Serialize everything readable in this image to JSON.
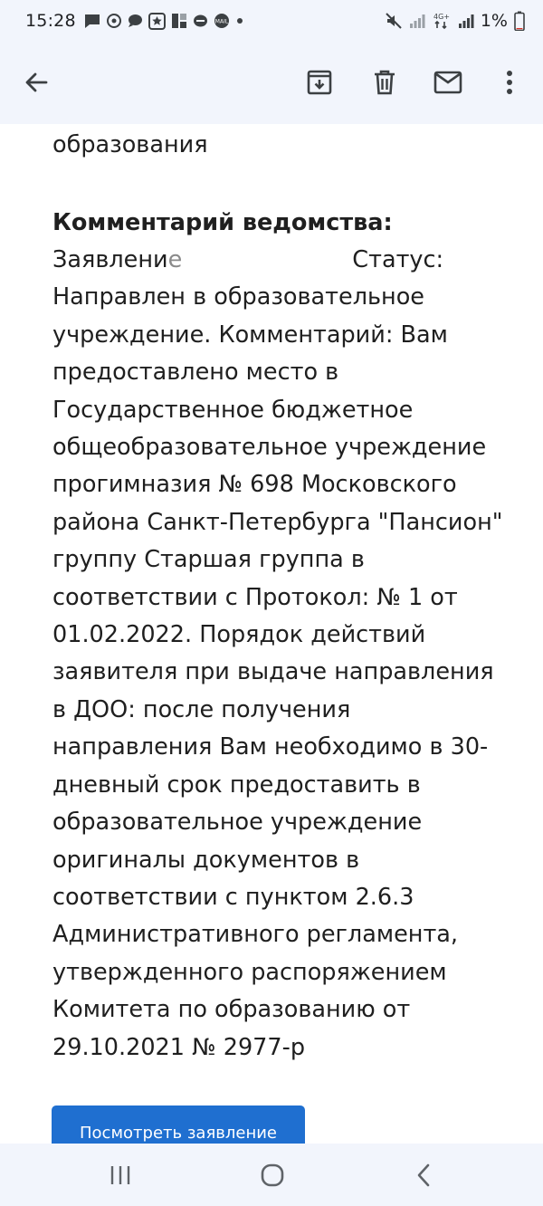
{
  "status_bar": {
    "time": "15:28",
    "battery": "1%",
    "network": "4G+",
    "notification_icons": [
      "message-icon",
      "whatsapp-icon",
      "chat-icon",
      "star-app-icon",
      "app-grid-icon",
      "chat-bubble-icon",
      "mail-ru-icon",
      "dot-icon"
    ],
    "mail_ru_label": "MAIL"
  },
  "toolbar": {
    "actions": [
      "back-arrow-icon",
      "archive-icon",
      "delete-icon",
      "mail-icon",
      "more-vert-icon"
    ]
  },
  "email": {
    "prev_line": "образования",
    "comment_title": "Комментарий ведомства:",
    "body_start": "Заявлени",
    "body_partial": "е",
    "body_after_redact": "Статус: Направлен в образовательное учреждение. Комментарий: Вам предоставлено место в Государственное бюджетное общеобразовательное учреждение прогимназия № 698 Московского района Санкт-Петербурга \"Пансион\" группу Старшая группа в соответствии с Протокол: № 1 от 01.02.2022. Порядок действий заявителя при выдаче направления в ДОО: после получения направления Вам необходимо в 30-дневный срок предоставить в образовательное учреждение оригиналы документов в соответствии с пунктом 2.6.3 Административного регламента, утвержденного распоряжением Комитета по образованию от 29.10.2021 № 2977-р",
    "view_button": "Посмотреть заявление"
  },
  "nav_bar": {
    "buttons": [
      "recents-icon",
      "home-icon",
      "back-icon"
    ]
  },
  "colors": {
    "chrome_bg": "#f2f5fc",
    "button_blue": "#1f6fd0",
    "text": "#1f1f1f"
  }
}
